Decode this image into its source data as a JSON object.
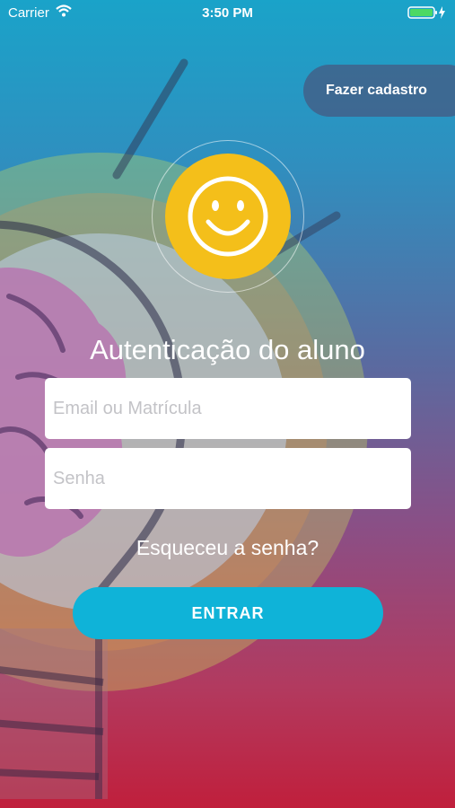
{
  "status_bar": {
    "carrier": "Carrier",
    "time": "3:50 PM",
    "icons": [
      "wifi-icon",
      "battery-icon",
      "charging-bolt-icon"
    ]
  },
  "header": {
    "register_label": "Fazer cadastro"
  },
  "avatar": {
    "icon": "smiley-face-icon",
    "color": "#f4bf1a"
  },
  "login": {
    "title": "Autenticação do aluno",
    "email_placeholder": "Email ou Matrícula",
    "email_value": "",
    "password_placeholder": "Senha",
    "password_value": "",
    "forgot_label": "Esqueceu a senha?",
    "submit_label": "ENTRAR"
  },
  "colors": {
    "accent": "#0fb3d8",
    "avatar_yellow": "#f4bf1a",
    "gradient_top": "#1aa3c9",
    "gradient_bottom": "#c01f3c"
  }
}
